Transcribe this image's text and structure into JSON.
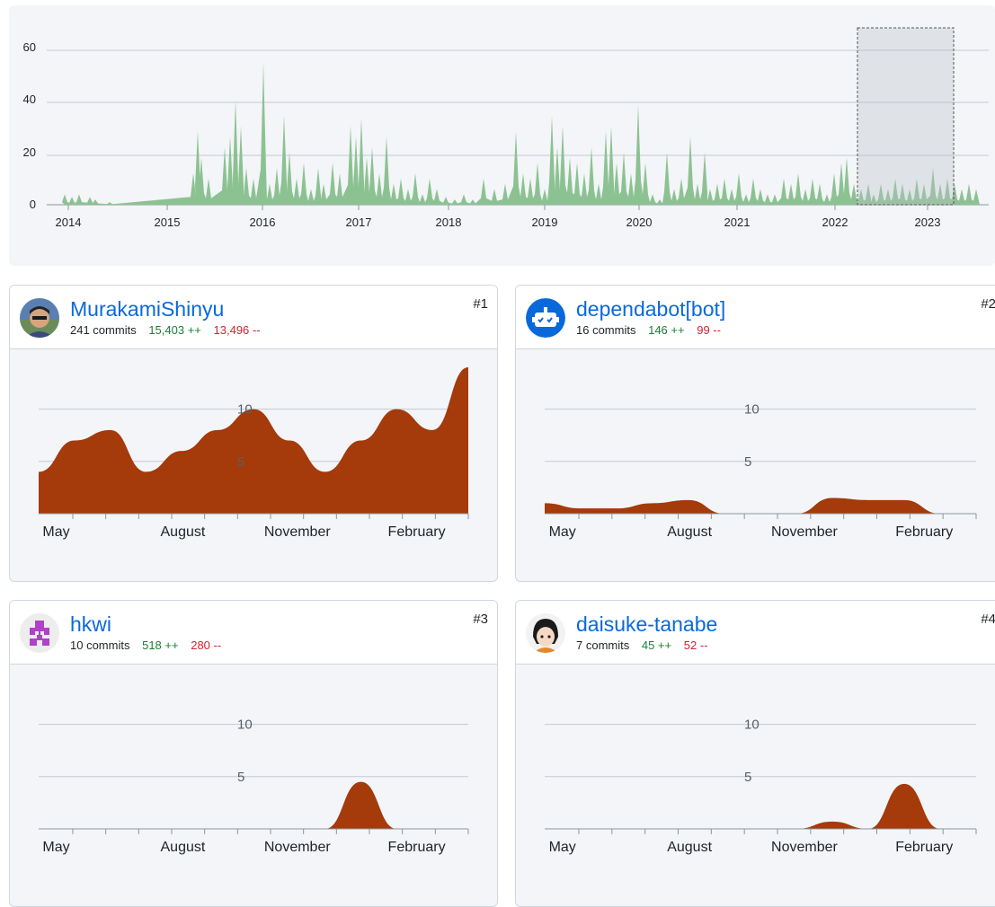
{
  "overview": {
    "y_ticks": [
      "60",
      "40",
      "20",
      "0"
    ],
    "x_ticks": [
      "2014",
      "2015",
      "2016",
      "2017",
      "2018",
      "2019",
      "2020",
      "2021",
      "2022",
      "2023"
    ],
    "series_color": "#8cc292",
    "selection_range": [
      "2022-04",
      "2023-03"
    ]
  },
  "contributors": [
    {
      "username": "MurakamiShinyu",
      "commits": "241 commits",
      "additions": "15,403 ++",
      "deletions": "13,496 --",
      "rank": "#1",
      "avatar_icon": "user-photo-avatar-icon"
    },
    {
      "username": "dependabot[bot]",
      "commits": "16 commits",
      "additions": "146 ++",
      "deletions": "99 --",
      "rank": "#2",
      "avatar_icon": "robot-avatar-icon"
    },
    {
      "username": "hkwi",
      "commits": "10 commits",
      "additions": "518 ++",
      "deletions": "280 --",
      "rank": "#3",
      "avatar_icon": "identicon-avatar-icon"
    },
    {
      "username": "daisuke-tanabe",
      "commits": "7 commits",
      "additions": "45 ++",
      "deletions": "52 --",
      "rank": "#4",
      "avatar_icon": "illustrated-avatar-icon"
    }
  ],
  "contributor_chart": {
    "y_ticks": [
      "10",
      "5"
    ],
    "x_ticks": [
      "May",
      "August",
      "November",
      "February"
    ],
    "series_color": "#a53a0a"
  },
  "chart_data": [
    {
      "type": "area",
      "title": "",
      "x_range": [
        "2013-11",
        "2023-07"
      ],
      "ylim": [
        0,
        67
      ],
      "grid": true,
      "series": [
        {
          "x": [
            "2014-01",
            "2014-05",
            "2015-03",
            "2015-06",
            "2015-09",
            "2016-01",
            "2016-06",
            "2017-01",
            "2017-06",
            "2018-01",
            "2018-06",
            "2019-01",
            "2019-06",
            "2020-01",
            "2020-06",
            "2021-01",
            "2021-06",
            "2022-01",
            "2022-06",
            "2023-01",
            "2023-06"
          ],
          "values": [
            3,
            1,
            18,
            28,
            41,
            54,
            33,
            32,
            20,
            4,
            10,
            34,
            29,
            38,
            20,
            18,
            6,
            16,
            8,
            16,
            8
          ]
        }
      ]
    },
    {
      "type": "area",
      "title": "MurakamiShinyu",
      "x": [
        "Apr",
        "May",
        "Jun",
        "Jul",
        "Aug",
        "Sep",
        "Oct",
        "Nov",
        "Dec",
        "Jan",
        "Feb",
        "Mar",
        "Apr"
      ],
      "values": [
        4,
        7,
        8,
        4,
        6,
        8,
        10,
        7,
        4,
        7,
        10,
        8,
        14
      ],
      "ylim": [
        0,
        14
      ]
    },
    {
      "type": "area",
      "title": "dependabot[bot]",
      "x": [
        "Apr",
        "May",
        "Jun",
        "Jul",
        "Aug",
        "Sep",
        "Oct",
        "Nov",
        "Dec",
        "Jan",
        "Feb",
        "Mar",
        "Apr"
      ],
      "values": [
        1,
        0.5,
        0.5,
        1,
        1.3,
        0,
        0,
        0,
        1.5,
        1.3,
        1.3,
        0,
        0
      ],
      "ylim": [
        0,
        14
      ]
    },
    {
      "type": "area",
      "title": "hkwi",
      "x": [
        "Apr",
        "May",
        "Jun",
        "Jul",
        "Aug",
        "Sep",
        "Oct",
        "Nov",
        "Dec",
        "Jan",
        "Feb",
        "Mar",
        "Apr"
      ],
      "values": [
        0,
        0,
        0,
        0,
        0,
        0,
        0,
        0,
        0,
        4.5,
        0,
        0,
        0
      ],
      "ylim": [
        0,
        14
      ]
    },
    {
      "type": "area",
      "title": "daisuke-tanabe",
      "x": [
        "Apr",
        "May",
        "Jun",
        "Jul",
        "Aug",
        "Sep",
        "Oct",
        "Nov",
        "Dec",
        "Jan",
        "Feb",
        "Mar",
        "Apr"
      ],
      "values": [
        0,
        0,
        0,
        0,
        0,
        0,
        0,
        0,
        0.7,
        0,
        4.3,
        0,
        0
      ],
      "ylim": [
        0,
        14
      ]
    }
  ]
}
